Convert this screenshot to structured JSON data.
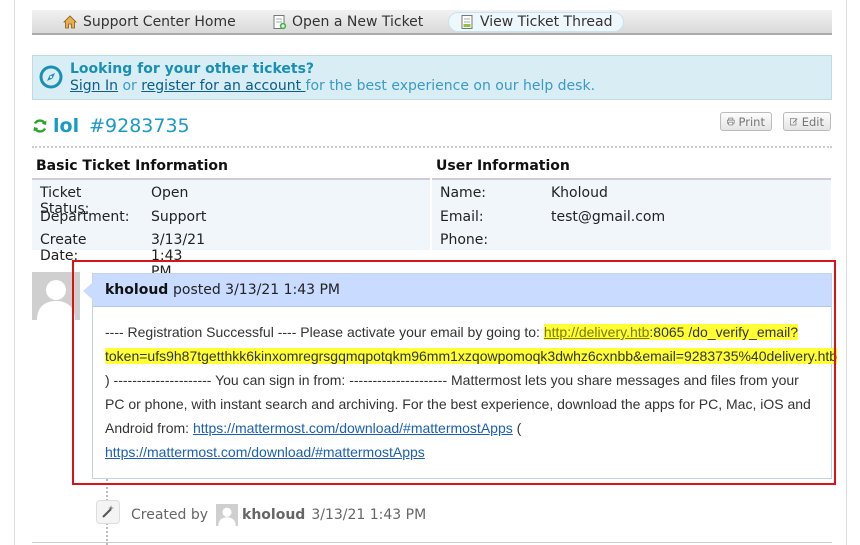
{
  "nav": {
    "items": [
      {
        "label": "Support Center Home",
        "icon": "home-icon"
      },
      {
        "label": "Open a New Ticket",
        "icon": "new-ticket-icon"
      },
      {
        "label": "View Ticket Thread",
        "icon": "ticket-thread-icon",
        "active": true
      }
    ]
  },
  "banner": {
    "title": "Looking for your other tickets?",
    "sign_in": "Sign In",
    "or": " or ",
    "register": "register for an account ",
    "rest": "for the best experience on our help desk."
  },
  "ticket": {
    "subject": "lol",
    "number": "#9283735",
    "print_label": "Print",
    "edit_label": "Edit"
  },
  "basic_info": {
    "heading": "Basic Ticket Information",
    "rows": [
      {
        "label": "Ticket Status:",
        "value": "Open"
      },
      {
        "label": "Department:",
        "value": "Support"
      },
      {
        "label": "Create Date:",
        "value": "3/13/21 1:43 PM"
      }
    ]
  },
  "user_info": {
    "heading": "User Information",
    "rows": [
      {
        "label": "Name:",
        "value": "Kholoud"
      },
      {
        "label": "Email:",
        "value": "test@gmail.com"
      },
      {
        "label": "Phone:",
        "value": ""
      }
    ]
  },
  "entry": {
    "author": "kholoud",
    "posted": "posted 3/13/21 1:43 PM",
    "body_1": "---- Registration Successful ---- Please activate your email by going to: ",
    "link_1": "http://delivery.htb",
    "link_1_rest": ":8065 /do_verify_email?token=ufs9h87tgetthkk6kinxomregrsgqmqpotqkm96mm1xzqowpomoqk3dwhz6cxnbb&email=9283735%40delivery.htb",
    "body_2": " ) --------------------- You can sign in from: --------------------- Mattermost lets you share messages and files from your PC or phone, with instant search and archiving. For the best experience, download the apps for PC, Mac, iOS and Android from: ",
    "link_2": "https://mattermost.com/download/#mattermostApps",
    "body_3": " ( ",
    "link_3": "https://mattermost.com/download/#mattermostApps"
  },
  "event": {
    "created_by": "Created by",
    "name": "kholoud",
    "time": "3/13/21 1:43 PM"
  },
  "colors": {
    "accent": "#1a9ac8",
    "highlight": "#ffff33",
    "red_box": "#d8141a",
    "entry_header": "#c9dcff"
  }
}
